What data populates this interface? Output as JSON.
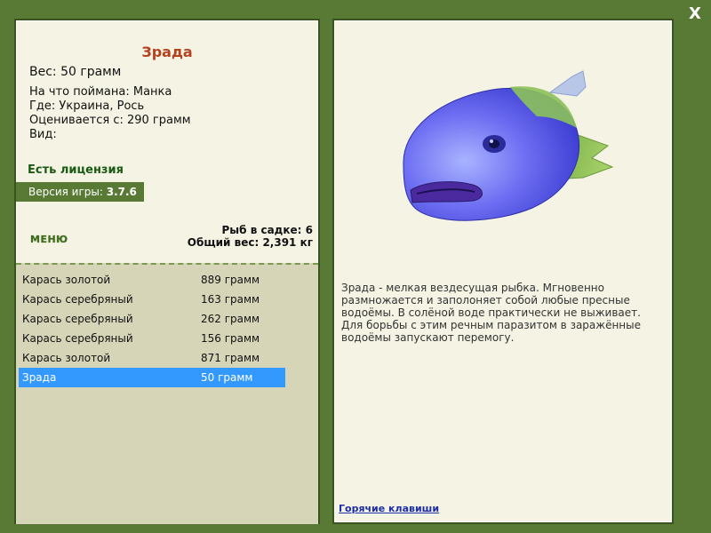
{
  "window": {
    "close_label": "X"
  },
  "fish": {
    "name": "Зрада",
    "weight_line": "Вес: 50 грамм",
    "bait_line": "На что поймана: Манка",
    "location_line": "Где: Украина, Рось",
    "trophy_line": "Оценивается с: 290 грамм",
    "species_line": "Вид:",
    "description": "Зрада - мелкая вездесущая рыбка. Мгновенно размножается и заполоняет собой любые пресные водоёмы. В солёной воде практически не выживает. Для борьбы с этим речным паразитом в заражённые водоёмы запускают перемогу."
  },
  "license_text": "Есть лицензия",
  "version": {
    "label": "Версия игры:",
    "value": "3.7.6"
  },
  "menu_label": "МЕНЮ",
  "keepnet": {
    "count_line": "Рыб в садке: 6",
    "total_line": "Общий вес: 2,391 кг"
  },
  "catch_list": [
    {
      "name": "Карась золотой",
      "weight": "889 грамм",
      "selected": false
    },
    {
      "name": "Карась серебряный",
      "weight": "163 грамм",
      "selected": false
    },
    {
      "name": "Карась серебряный",
      "weight": "262 грамм",
      "selected": false
    },
    {
      "name": "Карась серебряный",
      "weight": "156 грамм",
      "selected": false
    },
    {
      "name": "Карась золотой",
      "weight": "871 грамм",
      "selected": false
    },
    {
      "name": "Зрада",
      "weight": "50 грамм",
      "selected": true
    }
  ],
  "hotkeys_link": "Горячие клавиши",
  "colors": {
    "frame": "#587a34",
    "panel": "#f4f3e4",
    "list_bg": "#d6d5b8",
    "selection": "#3399ff",
    "title": "#b4421e"
  },
  "icons": {
    "close": "close-icon",
    "fish_picture": "fish-image"
  }
}
